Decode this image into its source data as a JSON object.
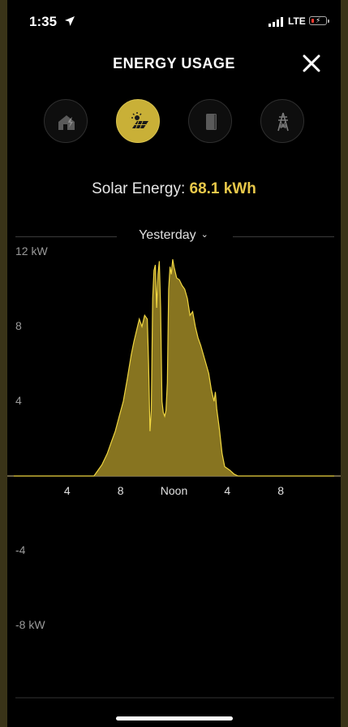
{
  "status_bar": {
    "time": "1:35",
    "network": "LTE"
  },
  "header": {
    "title": "ENERGY USAGE"
  },
  "tabs": [
    {
      "name": "home",
      "icon": "home-icon",
      "active": false
    },
    {
      "name": "solar",
      "icon": "solar-panel-icon",
      "active": true
    },
    {
      "name": "powerwall",
      "icon": "battery-icon",
      "active": false
    },
    {
      "name": "grid",
      "icon": "power-tower-icon",
      "active": false
    }
  ],
  "summary": {
    "label": "Solar Energy:",
    "value": "68.1 kWh"
  },
  "period": {
    "label": "Yesterday"
  },
  "colors": {
    "accent": "#e8c84a",
    "solar_fill": "#8e7a22",
    "solar_line": "#f0d640",
    "background": "#000000"
  },
  "chart_data": {
    "type": "area",
    "title": "",
    "ylim": [
      -12,
      12
    ],
    "y_tick_labels": [
      "12 kW",
      "8",
      "4",
      "-4",
      "-8 kW"
    ],
    "y_tick_values": [
      12,
      8,
      4,
      -4,
      -8
    ],
    "x_tick_labels": [
      "4",
      "8",
      "Noon",
      "4",
      "8"
    ],
    "x_tick_values": [
      4,
      8,
      12,
      16,
      20
    ],
    "xlim": [
      0,
      24
    ],
    "series": [
      {
        "values": [
          [
            0,
            0
          ],
          [
            6.0,
            0
          ],
          [
            6.3,
            0.3
          ],
          [
            6.6,
            0.6
          ],
          [
            7.0,
            1.2
          ],
          [
            7.3,
            1.8
          ],
          [
            7.6,
            2.4
          ],
          [
            7.9,
            3.2
          ],
          [
            8.2,
            4.0
          ],
          [
            8.5,
            5.2
          ],
          [
            8.8,
            6.5
          ],
          [
            9.0,
            7.2
          ],
          [
            9.2,
            7.8
          ],
          [
            9.4,
            8.4
          ],
          [
            9.6,
            8.0
          ],
          [
            9.8,
            8.6
          ],
          [
            10.0,
            8.4
          ],
          [
            10.1,
            6.0
          ],
          [
            10.2,
            2.4
          ],
          [
            10.3,
            3.5
          ],
          [
            10.4,
            9.5
          ],
          [
            10.5,
            11.0
          ],
          [
            10.6,
            11.3
          ],
          [
            10.7,
            9.0
          ],
          [
            10.8,
            10.8
          ],
          [
            10.9,
            11.5
          ],
          [
            11.0,
            9.0
          ],
          [
            11.1,
            4.0
          ],
          [
            11.2,
            3.4
          ],
          [
            11.3,
            3.2
          ],
          [
            11.4,
            3.5
          ],
          [
            11.5,
            5.0
          ],
          [
            11.6,
            10.0
          ],
          [
            11.7,
            11.2
          ],
          [
            11.8,
            10.8
          ],
          [
            11.9,
            11.6
          ],
          [
            12.0,
            11.2
          ],
          [
            12.2,
            10.6
          ],
          [
            12.4,
            10.5
          ],
          [
            12.6,
            10.2
          ],
          [
            12.8,
            10.0
          ],
          [
            13.0,
            9.5
          ],
          [
            13.2,
            8.6
          ],
          [
            13.4,
            8.8
          ],
          [
            13.6,
            8.0
          ],
          [
            13.8,
            7.4
          ],
          [
            14.0,
            7.0
          ],
          [
            14.2,
            6.5
          ],
          [
            14.4,
            6.0
          ],
          [
            14.6,
            5.5
          ],
          [
            14.8,
            4.6
          ],
          [
            15.0,
            4.0
          ],
          [
            15.1,
            4.5
          ],
          [
            15.2,
            3.6
          ],
          [
            15.4,
            2.5
          ],
          [
            15.6,
            1.2
          ],
          [
            15.8,
            0.5
          ],
          [
            16.0,
            0.4
          ],
          [
            16.2,
            0.3
          ],
          [
            16.5,
            0.1
          ],
          [
            16.8,
            0
          ],
          [
            24,
            0
          ]
        ]
      }
    ],
    "grid": false,
    "legend": "none"
  }
}
